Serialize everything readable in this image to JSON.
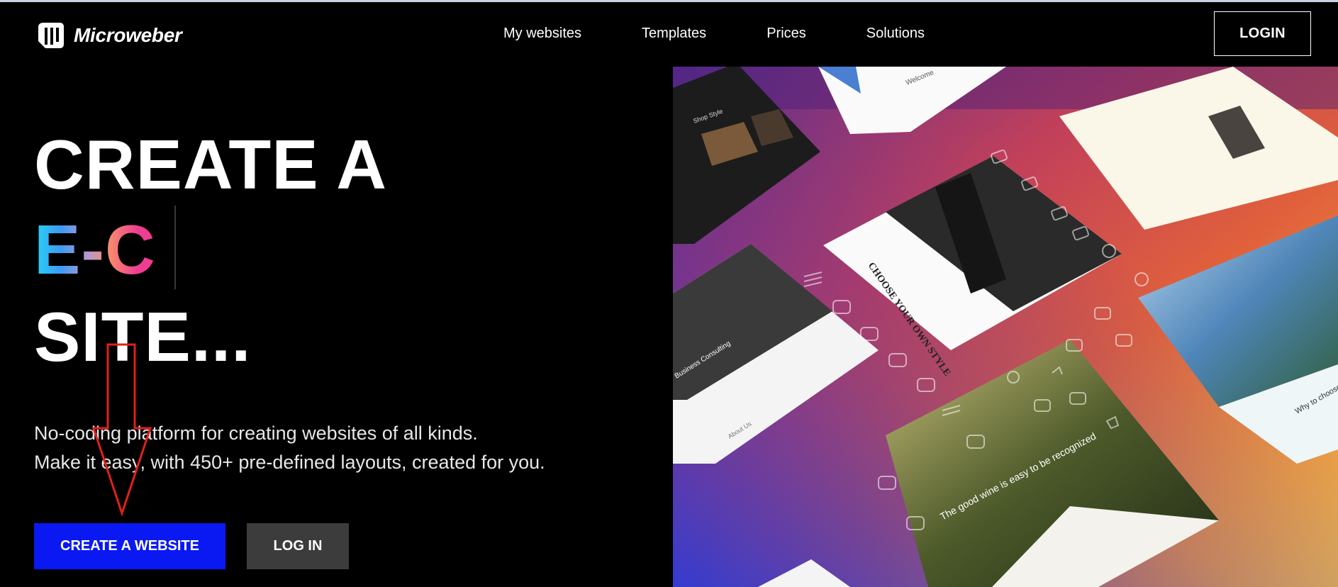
{
  "brand": {
    "name": "Microweber"
  },
  "nav": {
    "items": [
      {
        "label": "My websites"
      },
      {
        "label": "Templates"
      },
      {
        "label": "Prices"
      },
      {
        "label": "Solutions"
      }
    ],
    "login_label": "LOGIN"
  },
  "hero": {
    "line1": "CREATE A",
    "line2": "E-C",
    "line3": "SITE...",
    "subtitle1": "No-coding platform for creating websites of all kinds.",
    "subtitle2": "Make it easy, with 450+ pre-defined layouts, created for you.",
    "primary_button": "CREATE A WEBSITE",
    "secondary_button": "LOG IN"
  },
  "showcase": {
    "card_texts": {
      "choose_style": "CHOOSE YOUR OWN STYLE",
      "business": "Business Consulting",
      "about": "About Us",
      "wine": "The good wine is easy to be recognized",
      "why": "Why to choose",
      "shop": "Shop Style",
      "welcome": "Welcome"
    }
  },
  "colors": {
    "accent": "#0a19f2",
    "secondary_button": "#3c3c3c",
    "annotation_arrow": "#e0201a"
  }
}
